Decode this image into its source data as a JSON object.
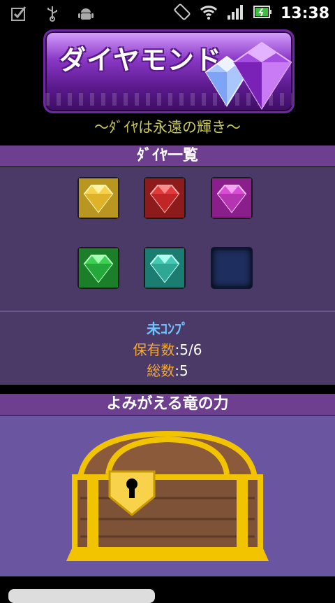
{
  "status_bar": {
    "time": "13:38",
    "left_icons": [
      "checkbox-icon",
      "usb-icon",
      "android-icon"
    ],
    "right_icons": [
      "rotate-icon",
      "wifi-icon",
      "signal-icon",
      "battery-icon"
    ]
  },
  "banner": {
    "title": "ダイヤモンド"
  },
  "subtitle": "〜ﾀﾞｲﾔは永遠の輝き〜",
  "diamond_list": {
    "heading": "ﾀﾞｲﾔ一覧",
    "gems": [
      {
        "color": "yellow",
        "hex": "#f5d24a",
        "owned": true
      },
      {
        "color": "red",
        "hex": "#e03a3a",
        "owned": true
      },
      {
        "color": "magenta",
        "hex": "#d84fd6",
        "owned": true
      },
      {
        "color": "green",
        "hex": "#3fcf53",
        "owned": true
      },
      {
        "color": "teal",
        "hex": "#45c9b4",
        "owned": true
      },
      {
        "color": "empty",
        "hex": "#1e2e5e",
        "owned": false
      }
    ],
    "status_label": "未ｺﾝﾌﾟ",
    "owned_label": "保有数",
    "owned_value": ":5/6",
    "total_label": "総数",
    "total_value": ":5"
  },
  "chest_section": {
    "heading": "よみがえる竜の力"
  }
}
